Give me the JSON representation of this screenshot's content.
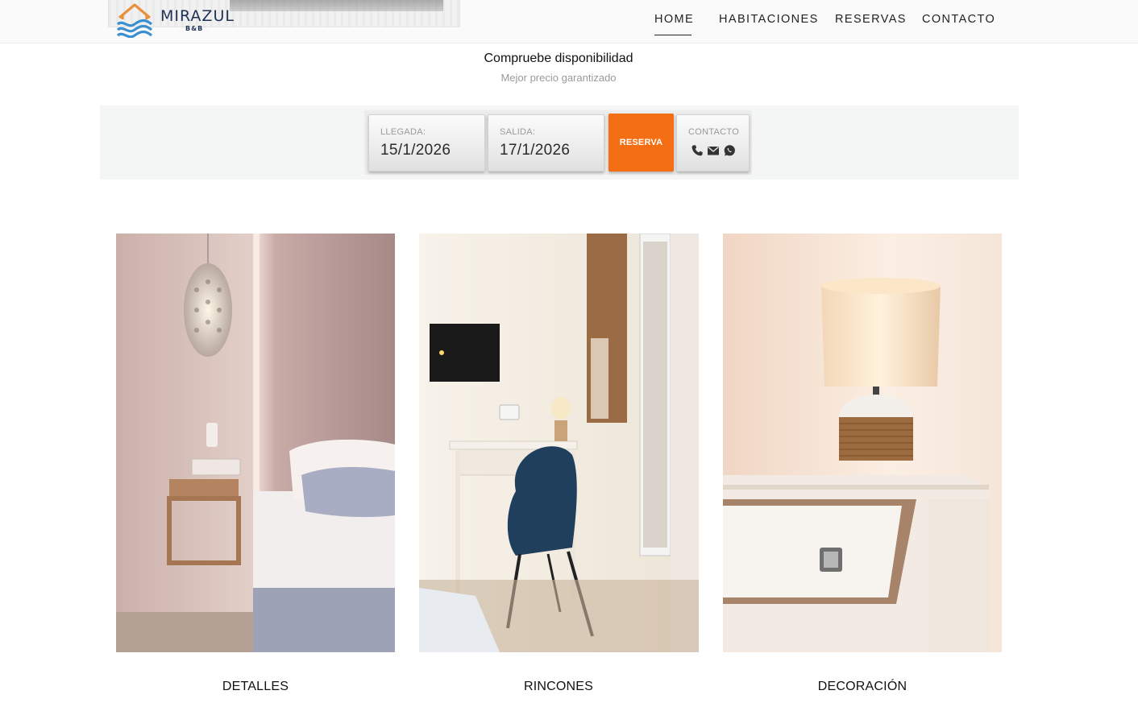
{
  "header": {
    "logo": {
      "name": "MIRAZUL",
      "sub": "B&B"
    },
    "nav": [
      {
        "label": "HOME",
        "active": true
      },
      {
        "label": "HABITACIONES",
        "active": false
      },
      {
        "label": "RESERVAS",
        "active": false
      },
      {
        "label": "CONTACTO",
        "active": false
      }
    ]
  },
  "availability": {
    "title": "Compruebe disponibilidad",
    "subtitle": "Mejor precio garantizado",
    "arrival": {
      "label": "LLEGADA:",
      "value": "15/1/2026"
    },
    "departure": {
      "label": "SALIDA:",
      "value": "17/1/2026"
    },
    "reserve_button": "RESERVA",
    "contact": {
      "label": "CONTACTO",
      "icons": [
        "phone-icon",
        "mail-icon",
        "whatsapp-icon"
      ]
    }
  },
  "gallery": [
    {
      "caption": "DETALLES"
    },
    {
      "caption": "RINCONES"
    },
    {
      "caption": "DECORACIÓN"
    }
  ],
  "colors": {
    "accent": "#f46f14",
    "brand": "#1f3156",
    "logo_orange": "#e8913a",
    "logo_blue": "#3a8fd1"
  }
}
